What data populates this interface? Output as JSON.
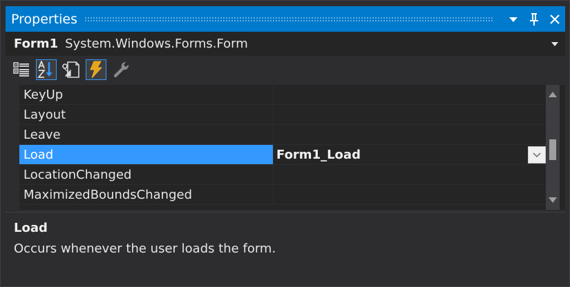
{
  "window": {
    "title": "Properties"
  },
  "object_selector": {
    "name": "Form1",
    "type": "System.Windows.Forms.Form"
  },
  "toolbar": {
    "buttons": [
      {
        "icon": "categorized-icon",
        "active": false
      },
      {
        "icon": "alphabetical-sort-icon",
        "active": true
      },
      {
        "icon": "properties-icon",
        "active": false
      },
      {
        "icon": "events-lightning-icon",
        "active": true
      },
      {
        "icon": "property-pages-wrench-icon",
        "active": false
      }
    ]
  },
  "grid": {
    "rows": [
      {
        "name": "KeyUp",
        "value": ""
      },
      {
        "name": "Layout",
        "value": ""
      },
      {
        "name": "Leave",
        "value": ""
      },
      {
        "name": "Load",
        "value": "Form1_Load",
        "selected": true
      },
      {
        "name": "LocationChanged",
        "value": ""
      },
      {
        "name": "MaximizedBoundsChanged",
        "value": ""
      }
    ]
  },
  "description": {
    "title": "Load",
    "text": "Occurs whenever the user loads the form."
  },
  "colors": {
    "accent": "#007acc",
    "selection": "#3399ff",
    "background": "#2d2d30",
    "grid_background": "#252526"
  }
}
